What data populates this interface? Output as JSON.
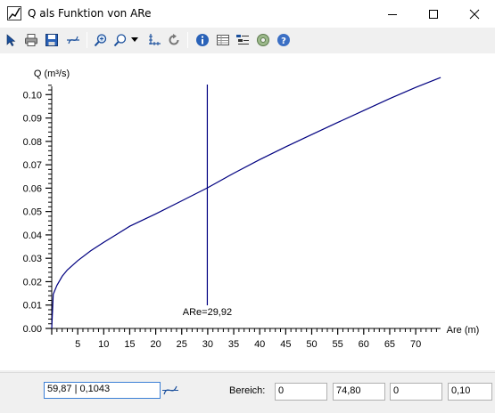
{
  "window": {
    "title": "Q als Funktion von ARe"
  },
  "toolbar": {
    "buttons": [
      {
        "name": "pointer-icon"
      },
      {
        "name": "print-icon"
      },
      {
        "name": "save-icon"
      },
      {
        "name": "curve-tool-icon"
      },
      {
        "name": "zoom-in-icon"
      },
      {
        "name": "zoom-menu-icon"
      },
      {
        "name": "dropdown-arrow-icon"
      },
      {
        "name": "axes-icon"
      },
      {
        "name": "refresh-icon"
      },
      {
        "name": "info-icon"
      },
      {
        "name": "table-icon"
      },
      {
        "name": "legend-icon"
      },
      {
        "name": "settings-icon"
      },
      {
        "name": "help-icon"
      }
    ]
  },
  "chart_data": {
    "type": "line",
    "ylabel": "Q (m³/s)",
    "xlabel": "Are (m)",
    "xlim": [
      0,
      74.8
    ],
    "ylim": [
      0,
      0.104
    ],
    "x_ticks": [
      "5",
      "10",
      "15",
      "20",
      "25",
      "30",
      "35",
      "40",
      "45",
      "50",
      "55",
      "60",
      "65",
      "70"
    ],
    "y_ticks": [
      "0.00",
      "0.01",
      "0.02",
      "0.03",
      "0.04",
      "0.05",
      "0.06",
      "0.07",
      "0.08",
      "0.09",
      "0.10"
    ],
    "series": [
      {
        "color": "#000080",
        "x": [
          0,
          0.3,
          1,
          2,
          3,
          5,
          7.5,
          10,
          15,
          20,
          25,
          30,
          35,
          40,
          45,
          50,
          55,
          60,
          65,
          70,
          74.8
        ],
        "y": [
          0.0,
          0.0146,
          0.0184,
          0.0223,
          0.025,
          0.029,
          0.0332,
          0.0368,
          0.0437,
          0.049,
          0.0546,
          0.0602,
          0.0664,
          0.0722,
          0.0777,
          0.0829,
          0.0881,
          0.0932,
          0.0983,
          0.1031,
          0.1073
        ]
      }
    ],
    "marker": {
      "x": 29.92,
      "label": "ARe=29,92"
    }
  },
  "status": {
    "coordinate_value": "59,87 | 0,1043",
    "range_label": "Bereich:",
    "range_values": [
      "0",
      "74,80",
      "0",
      "0,10"
    ]
  }
}
